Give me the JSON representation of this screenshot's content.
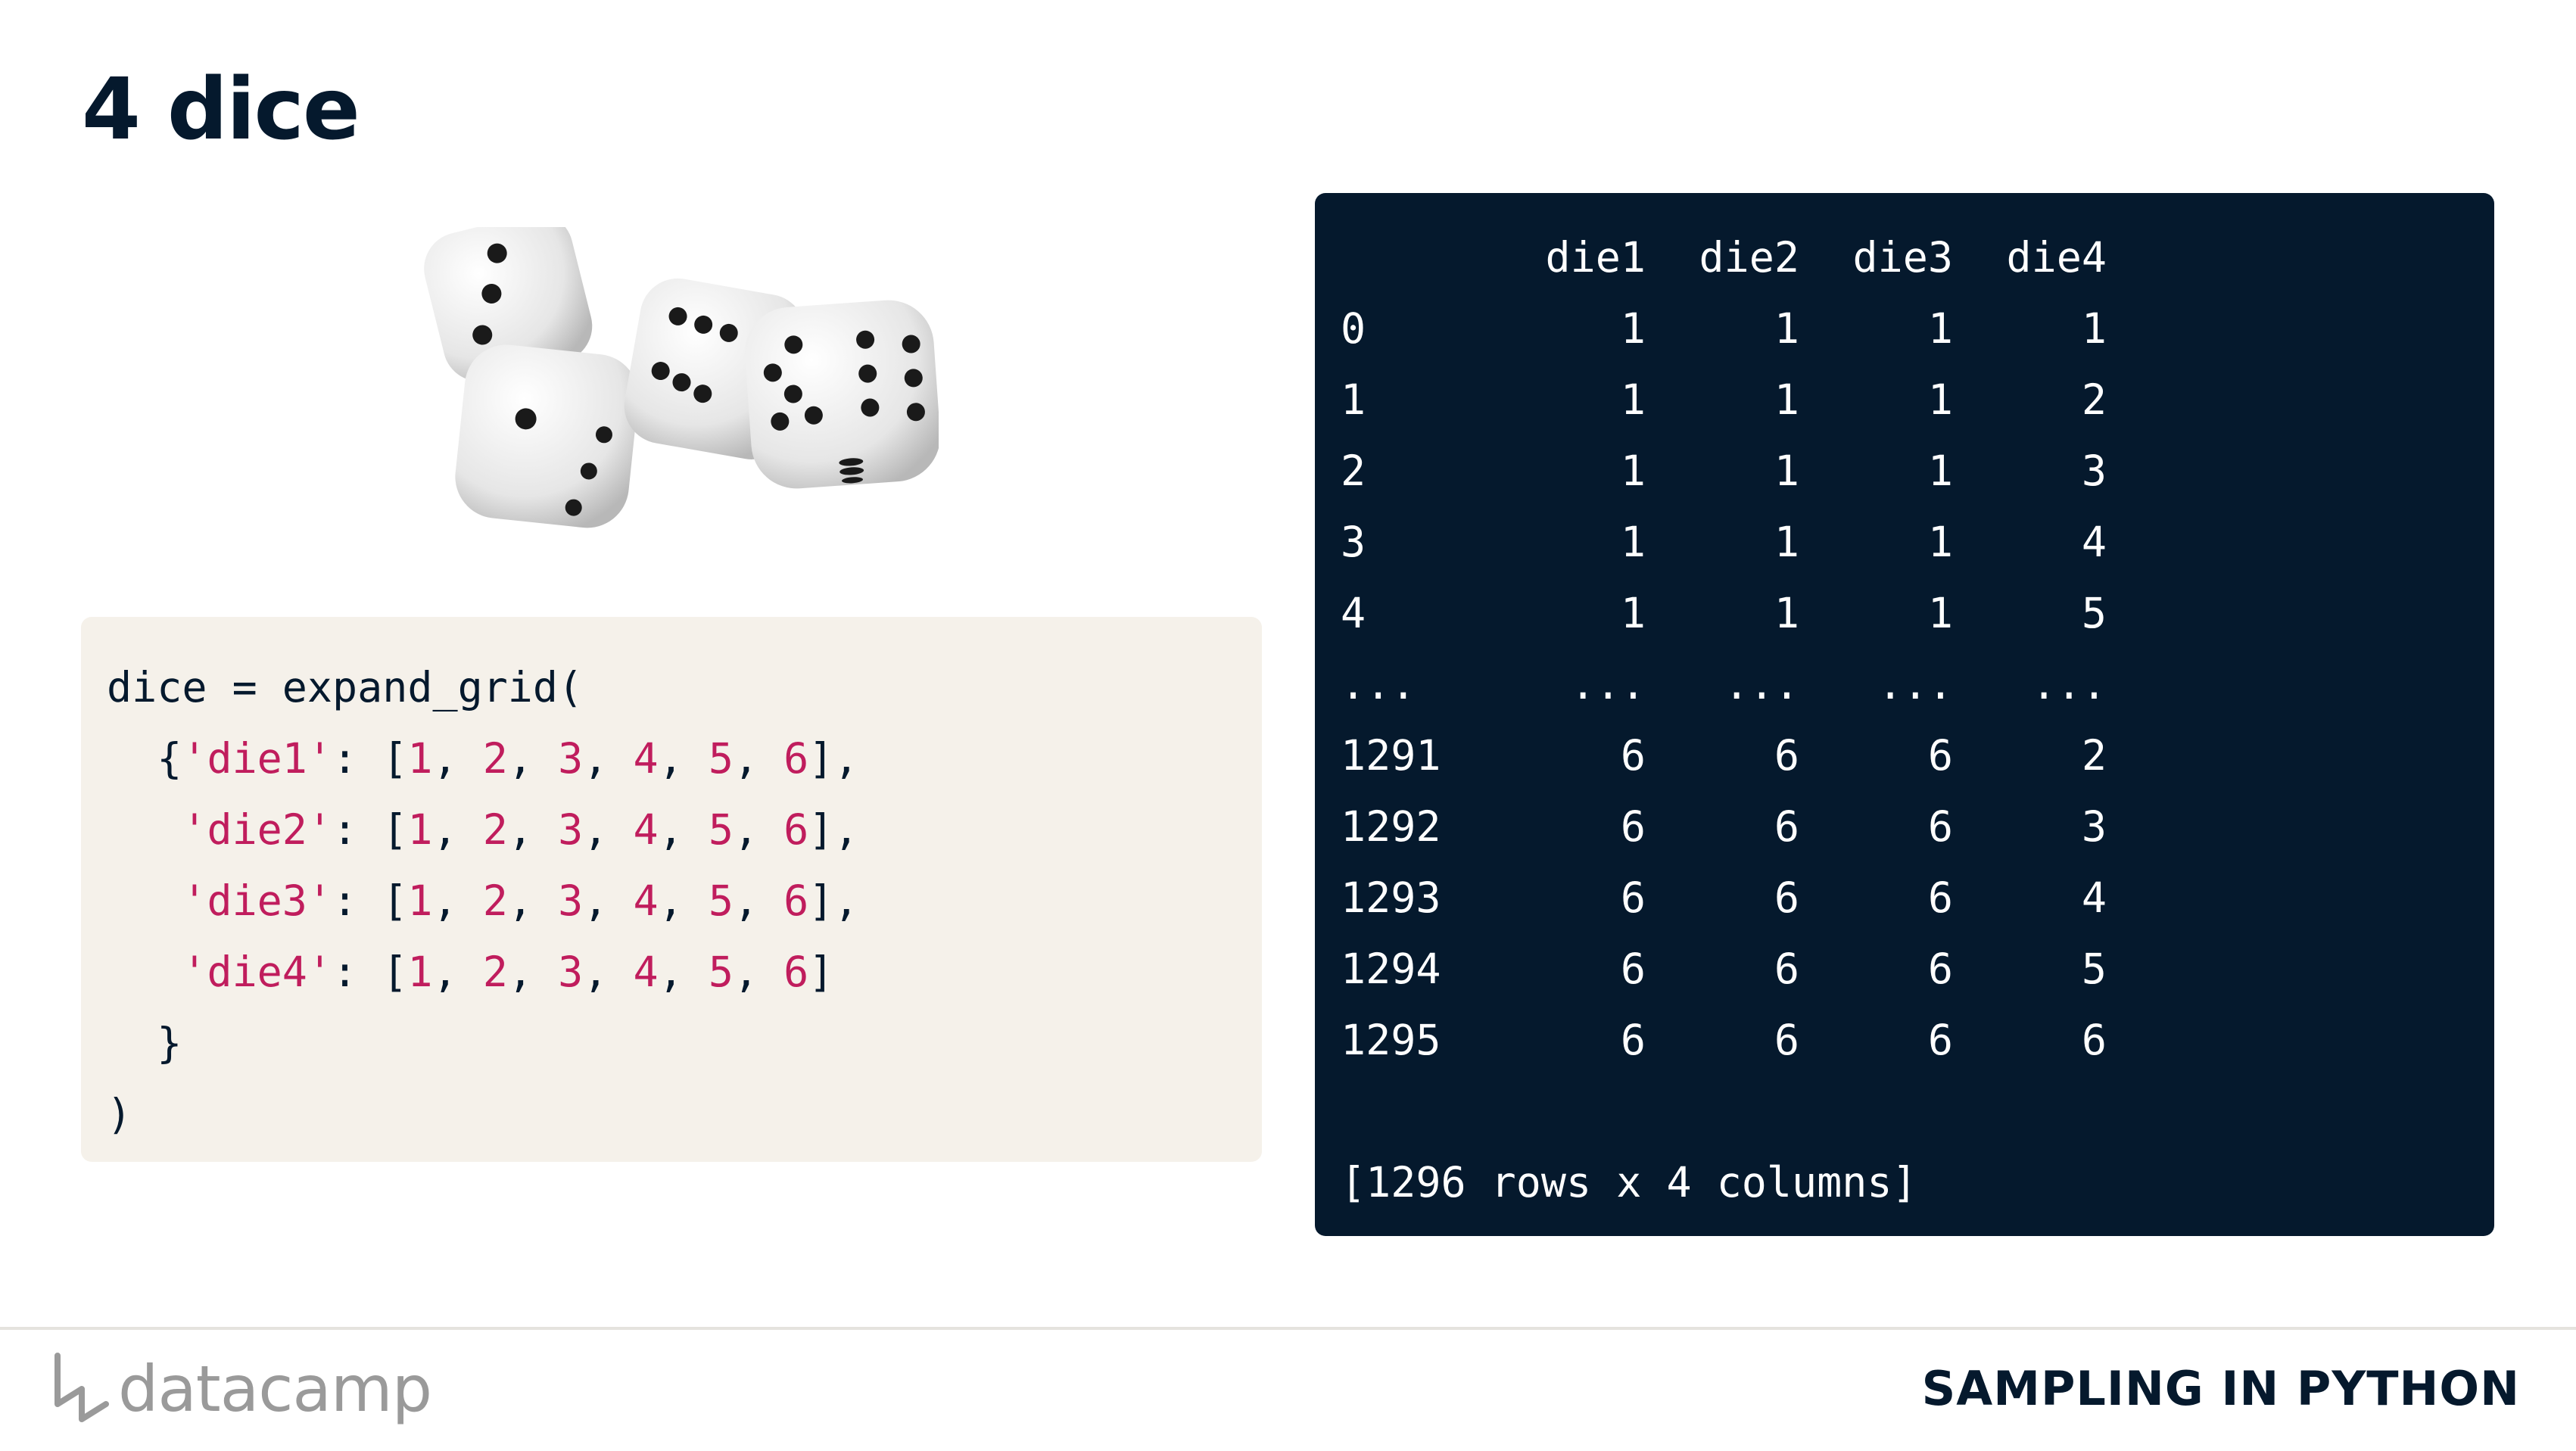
{
  "slide": {
    "title": "4 dice",
    "course_name": "SAMPLING IN PYTHON",
    "brand": "datacamp"
  },
  "code": {
    "line1": "dice = expand_grid(",
    "rows": [
      {
        "key": "'die1'",
        "values": [
          "1",
          "2",
          "3",
          "4",
          "5",
          "6"
        ],
        "trail": "],"
      },
      {
        "key": "'die2'",
        "values": [
          "1",
          "2",
          "3",
          "4",
          "5",
          "6"
        ],
        "trail": "],"
      },
      {
        "key": "'die3'",
        "values": [
          "1",
          "2",
          "3",
          "4",
          "5",
          "6"
        ],
        "trail": "],"
      },
      {
        "key": "'die4'",
        "values": [
          "1",
          "2",
          "3",
          "4",
          "5",
          "6"
        ],
        "trail": "]"
      }
    ],
    "close_brace": "}",
    "close_paren": ")"
  },
  "output": {
    "columns": [
      "die1",
      "die2",
      "die3",
      "die4"
    ],
    "rows": [
      {
        "index": "0",
        "values": [
          "1",
          "1",
          "1",
          "1"
        ]
      },
      {
        "index": "1",
        "values": [
          "1",
          "1",
          "1",
          "2"
        ]
      },
      {
        "index": "2",
        "values": [
          "1",
          "1",
          "1",
          "3"
        ]
      },
      {
        "index": "3",
        "values": [
          "1",
          "1",
          "1",
          "4"
        ]
      },
      {
        "index": "4",
        "values": [
          "1",
          "1",
          "1",
          "5"
        ]
      },
      {
        "index": "...",
        "values": [
          "...",
          "...",
          "...",
          "..."
        ]
      },
      {
        "index": "1291",
        "values": [
          "6",
          "6",
          "6",
          "2"
        ]
      },
      {
        "index": "1292",
        "values": [
          "6",
          "6",
          "6",
          "3"
        ]
      },
      {
        "index": "1293",
        "values": [
          "6",
          "6",
          "6",
          "4"
        ]
      },
      {
        "index": "1294",
        "values": [
          "6",
          "6",
          "6",
          "5"
        ]
      },
      {
        "index": "1295",
        "values": [
          "6",
          "6",
          "6",
          "6"
        ]
      }
    ],
    "summary": "[1296 rows x 4 columns]"
  },
  "colors": {
    "title": "#05192d",
    "code_bg": "#f5f1ea",
    "output_bg": "#05192d",
    "string_number": "#c01d5d"
  }
}
